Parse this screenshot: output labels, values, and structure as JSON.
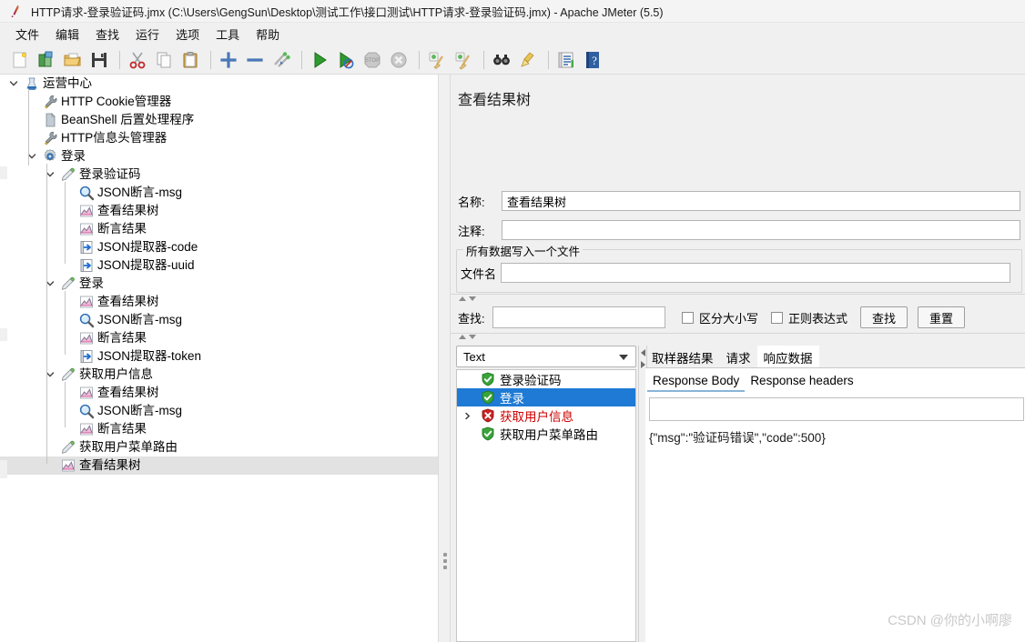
{
  "window": {
    "title": "HTTP请求-登录验证码.jmx (C:\\Users\\GengSun\\Desktop\\测试工作\\接口测试\\HTTP请求-登录验证码.jmx) - Apache JMeter (5.5)",
    "app_icon": "jmeter-feather-icon"
  },
  "menubar": {
    "items": [
      {
        "label": "文件"
      },
      {
        "label": "编辑"
      },
      {
        "label": "查找"
      },
      {
        "label": "运行"
      },
      {
        "label": "选项"
      },
      {
        "label": "工具"
      },
      {
        "label": "帮助"
      }
    ]
  },
  "toolbar": {
    "buttons": [
      {
        "name": "new-icon",
        "label": "新建"
      },
      {
        "name": "templates-icon",
        "label": "模板"
      },
      {
        "name": "open-icon",
        "label": "打开"
      },
      {
        "name": "save-icon",
        "label": "保存"
      },
      {
        "name": "cut-icon",
        "label": "剪切"
      },
      {
        "name": "copy-icon",
        "label": "复制"
      },
      {
        "name": "paste-icon",
        "label": "粘贴"
      },
      {
        "name": "expand-all-icon",
        "label": "展开全部"
      },
      {
        "name": "collapse-all-icon",
        "label": "折叠全部"
      },
      {
        "name": "toggle-icon",
        "label": "切换"
      },
      {
        "name": "start-icon",
        "label": "启动"
      },
      {
        "name": "start-no-pauses-icon",
        "label": "无间隔启动"
      },
      {
        "name": "stop-icon",
        "label": "停止"
      },
      {
        "name": "shutdown-icon",
        "label": "关闭"
      },
      {
        "name": "clear-icon",
        "label": "清除"
      },
      {
        "name": "clear-all-icon",
        "label": "清除全部"
      },
      {
        "name": "search-icon",
        "label": "搜索"
      },
      {
        "name": "search-reset-icon",
        "label": "重置搜索"
      },
      {
        "name": "function-helper-icon",
        "label": "函数助手对话框"
      },
      {
        "name": "help-icon",
        "label": "帮助"
      }
    ]
  },
  "tree": {
    "nodes": [
      {
        "label": "运营中心",
        "icon": "test-plan-icon",
        "depth": 0,
        "toggle": "open"
      },
      {
        "label": "HTTP Cookie管理器",
        "icon": "config-tools-icon",
        "depth": 1,
        "toggle": "none"
      },
      {
        "label": "BeanShell 后置处理程序",
        "icon": "postprocessor-icon",
        "depth": 1,
        "toggle": "none"
      },
      {
        "label": "HTTP信息头管理器",
        "icon": "config-tools-icon",
        "depth": 1,
        "toggle": "none"
      },
      {
        "label": "登录",
        "icon": "thread-group-icon",
        "depth": 1,
        "toggle": "open"
      },
      {
        "label": "登录验证码",
        "icon": "sampler-icon",
        "depth": 2,
        "toggle": "open"
      },
      {
        "label": "JSON断言-msg",
        "icon": "assertion-icon",
        "depth": 3,
        "toggle": "none"
      },
      {
        "label": "查看结果树",
        "icon": "listener-icon",
        "depth": 3,
        "toggle": "none"
      },
      {
        "label": "断言结果",
        "icon": "listener-icon",
        "depth": 3,
        "toggle": "none"
      },
      {
        "label": "JSON提取器-code",
        "icon": "postprocessor-extractor-icon",
        "depth": 3,
        "toggle": "none"
      },
      {
        "label": "JSON提取器-uuid",
        "icon": "postprocessor-extractor-icon",
        "depth": 3,
        "toggle": "none"
      },
      {
        "label": "登录",
        "icon": "sampler-icon",
        "depth": 2,
        "toggle": "open"
      },
      {
        "label": "查看结果树",
        "icon": "listener-icon",
        "depth": 3,
        "toggle": "none"
      },
      {
        "label": "JSON断言-msg",
        "icon": "assertion-icon",
        "depth": 3,
        "toggle": "none"
      },
      {
        "label": "断言结果",
        "icon": "listener-icon",
        "depth": 3,
        "toggle": "none"
      },
      {
        "label": "JSON提取器-token",
        "icon": "postprocessor-extractor-icon",
        "depth": 3,
        "toggle": "none"
      },
      {
        "label": "获取用户信息",
        "icon": "sampler-icon",
        "depth": 2,
        "toggle": "open"
      },
      {
        "label": "查看结果树",
        "icon": "listener-icon",
        "depth": 3,
        "toggle": "none"
      },
      {
        "label": "JSON断言-msg",
        "icon": "assertion-icon",
        "depth": 3,
        "toggle": "none"
      },
      {
        "label": "断言结果",
        "icon": "listener-icon",
        "depth": 3,
        "toggle": "none"
      },
      {
        "label": "获取用户菜单路由",
        "icon": "sampler-icon",
        "depth": 2,
        "toggle": "none"
      },
      {
        "label": "查看结果树",
        "icon": "listener-icon",
        "depth": 2,
        "toggle": "none",
        "selected": true
      }
    ]
  },
  "editor": {
    "title": "查看结果树",
    "name_label": "名称:",
    "name_value": "查看结果树",
    "comment_label": "注释:",
    "comment_value": "",
    "file_group_title": "所有数据写入一个文件",
    "filename_label": "文件名",
    "filename_value": "",
    "search": {
      "label": "查找:",
      "value": "",
      "case_sensitive_label": "区分大小写",
      "regex_label": "正则表达式",
      "find_button": "查找",
      "reset_button": "重置"
    },
    "renderer": {
      "selected": "Text"
    },
    "results": [
      {
        "label": "登录验证码",
        "status": "ok",
        "expandable": false
      },
      {
        "label": "登录",
        "status": "ok",
        "expandable": false,
        "selected": true
      },
      {
        "label": "获取用户信息",
        "status": "error",
        "expandable": true
      },
      {
        "label": "获取用户菜单路由",
        "status": "ok",
        "expandable": false
      }
    ],
    "tabs": [
      {
        "label": "取样器结果",
        "active": false
      },
      {
        "label": "请求",
        "active": false
      },
      {
        "label": "响应数据",
        "active": true
      }
    ],
    "subtabs": [
      {
        "label": "Response Body",
        "active": true
      },
      {
        "label": "Response headers",
        "active": false
      }
    ],
    "response_search_value": "",
    "response_body": "{\"msg\":\"验证码错误\",\"code\":500}"
  },
  "watermark": "CSDN @你的小啊廖",
  "colors": {
    "selection_blue": "#1e7ad4",
    "error_red": "#cc0000",
    "ok_green": "#37a13a",
    "panel_bg": "#f0f0f0"
  }
}
